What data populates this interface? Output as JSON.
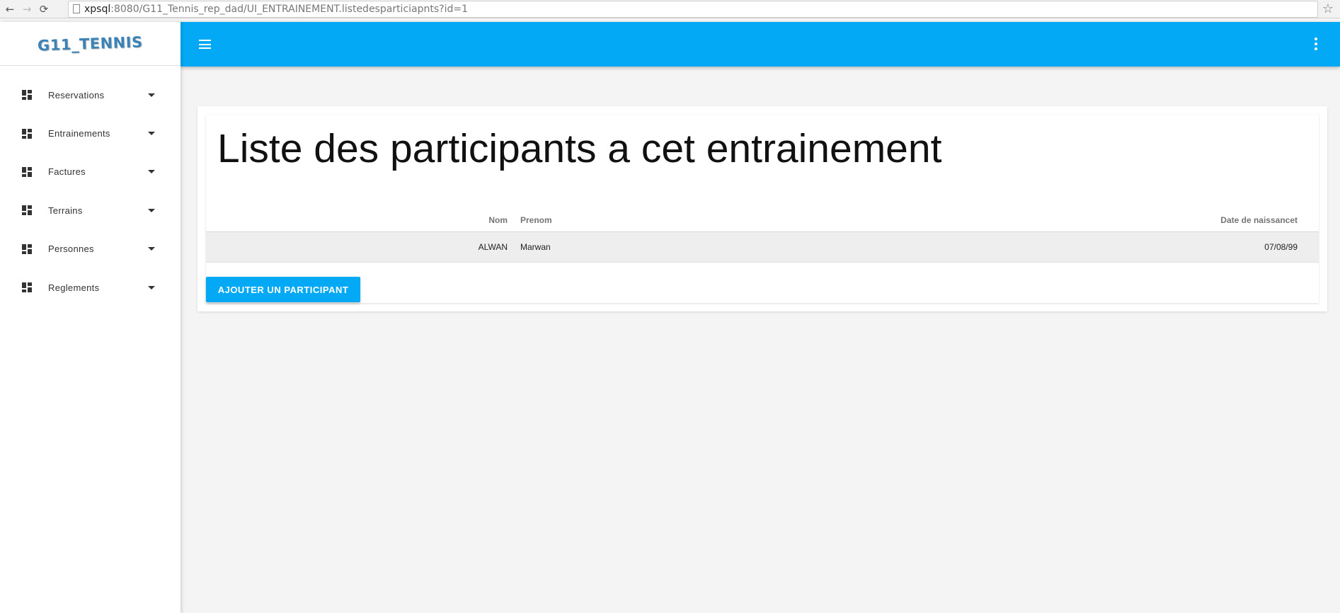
{
  "browser": {
    "back_icon": "←",
    "forward_icon": "→",
    "reload_icon": "⟳",
    "url_host": "xpsql",
    "url_rest": ":8080/G11_Tennis_rep_dad/UI_ENTRAINEMENT.listedesparticiapnts?id=1",
    "star_icon": "☆"
  },
  "sidebar": {
    "logo": "G11_TENNIS",
    "items": [
      {
        "label": "Reservations",
        "icon": "dashboard-icon"
      },
      {
        "label": "Entrainements",
        "icon": "dashboard-icon"
      },
      {
        "label": "Factures",
        "icon": "dashboard-icon"
      },
      {
        "label": "Terrains",
        "icon": "dashboard-icon"
      },
      {
        "label": "Personnes",
        "icon": "dashboard-icon"
      },
      {
        "label": "Reglements",
        "icon": "dashboard-icon"
      }
    ]
  },
  "header": {
    "accent_color": "#03a9f4",
    "menu_icon": "hamburger-icon",
    "more_icon": "more-vert-icon"
  },
  "main": {
    "title": "Liste des participants a cet entrainement",
    "table": {
      "columns": [
        "Nom",
        "Prenom",
        "Date de naissancet"
      ],
      "rows": [
        {
          "nom": "ALWAN",
          "prenom": "Marwan",
          "date": "07/08/99"
        }
      ]
    },
    "add_button": "AJOUTER UN PARTICIPANT"
  }
}
